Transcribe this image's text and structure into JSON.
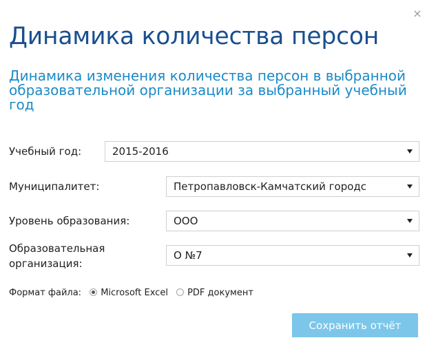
{
  "dialog": {
    "title": "Динамика количества персон",
    "subtitle": "Динамика изменения количества персон в выбранной образовательной организации за выбранный учебный год",
    "close_label": "×"
  },
  "form": {
    "year": {
      "label": "Учебный год:",
      "value": "2015-2016"
    },
    "municipality": {
      "label": "Муниципалитет:",
      "value": "Петропавловск-Камчатский городс"
    },
    "level": {
      "label": "Уровень образования:",
      "value": "ООО"
    },
    "organization": {
      "label_line1": "Образовательная",
      "label_line2": "организация:",
      "value": "О №7"
    },
    "format": {
      "label": "Формат файла:",
      "options": [
        {
          "label": "Microsoft Excel",
          "checked": true
        },
        {
          "label": "PDF документ",
          "checked": false
        }
      ]
    },
    "save_label": "Сохранить отчёт"
  },
  "colors": {
    "title": "#1a4f8f",
    "subtitle": "#1a8ac6",
    "button": "#7cc6ea"
  }
}
